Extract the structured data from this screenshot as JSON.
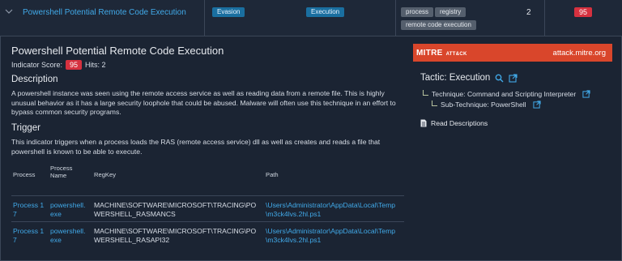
{
  "row": {
    "title": "Powershell Potential Remote Code Execution",
    "tags": {
      "tactic_badge": "Evasion",
      "tactic2_badge": "Execution",
      "labels": [
        "process",
        "registry",
        "remote code execution"
      ]
    },
    "count": "2",
    "score_badge": "95"
  },
  "detail": {
    "title": "Powershell Potential Remote Code Execution",
    "indicator_score_label": "Indicator Score:",
    "indicator_score": "95",
    "hits_label": "Hits: 2",
    "description_heading": "Description",
    "description_text": "A powershell instance was seen using the remote access service as well as reading data from a remote file. This is highly unusual behavior as it has a large security loophole that could be abused. Malware will often use this technique in an effort to bypass common security programs.",
    "trigger_heading": "Trigger",
    "trigger_text": "This indicator triggers when a process loads the RAS (remote access service) dll as well as creates and reads a file that powershell is known to be able to execute.",
    "table": {
      "headers": [
        "Process",
        "Process Name",
        "RegKey",
        "Path"
      ],
      "rows": [
        [
          "Process 17",
          "powershell.exe",
          "MACHINE\\SOFTWARE\\MICROSOFT\\TRACING\\POWERSHELL_RASMANCS",
          "\\Users\\Administrator\\AppData\\Local\\Temp\\m3ck4lvs.2hl.ps1"
        ],
        [
          "Process 17",
          "powershell.exe",
          "MACHINE\\SOFTWARE\\MICROSOFT\\TRACING\\POWERSHELL_RASAPI32",
          "\\Users\\Administrator\\AppData\\Local\\Temp\\m3ck4lvs.2hl.ps1"
        ]
      ]
    }
  },
  "mitre": {
    "logo_text": "MITRE",
    "logo_sub": "ATT&CK",
    "url": "attack.mitre.org",
    "tactic_label": "Tactic: Execution",
    "technique_label": "Technique: Command and Scripting Interpreter",
    "subtechnique_label": "Sub-Technique: PowerShell",
    "read_descriptions": "Read Descriptions"
  },
  "colors": {
    "background": "#1b2433",
    "link": "#41a9e8",
    "badge_blue": "#1a6fa0",
    "badge_red": "#d6313f",
    "mitre_orange": "#d9462b"
  },
  "icons": [
    "chevron-down-icon",
    "search-icon",
    "external-link-icon",
    "document-icon"
  ]
}
